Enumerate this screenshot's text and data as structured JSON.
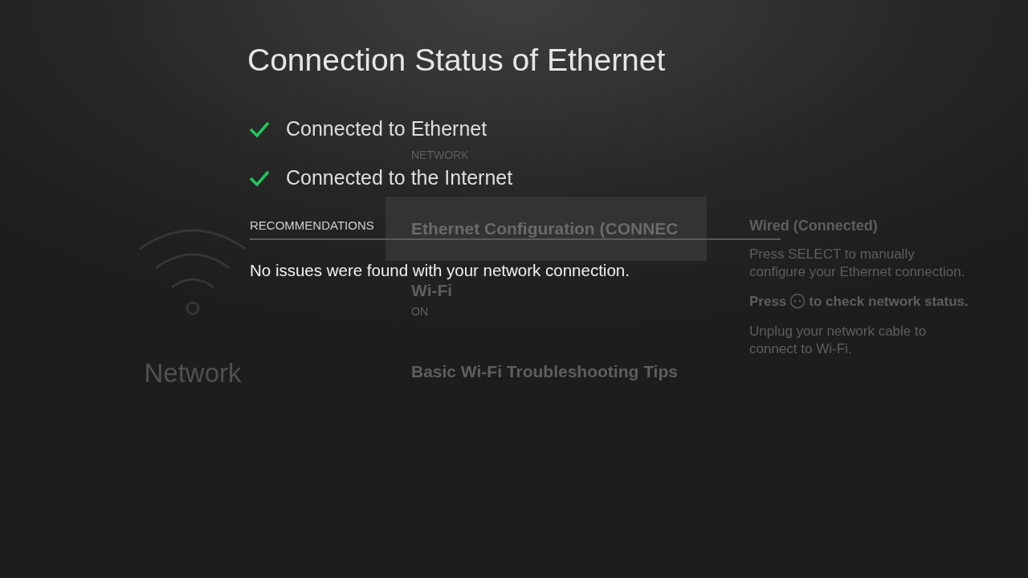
{
  "background": {
    "sidebar": {
      "title": "Network"
    },
    "menu": {
      "heading": "NETWORK",
      "items": [
        {
          "label": "Ethernet Configuration (CONNEC",
          "selected": true
        },
        {
          "label": "Wi-Fi",
          "subtitle": "ON",
          "selected": false
        },
        {
          "label": "Basic Wi-Fi Troubleshooting Tips",
          "selected": false
        }
      ]
    },
    "details": {
      "title": "Wired (Connected)",
      "paragraphs": [
        {
          "kind": "text",
          "text": "Press SELECT to manually configure your Ethernet connection."
        },
        {
          "kind": "button_hint",
          "before": "Press",
          "after": "to check network status."
        },
        {
          "kind": "text",
          "text": "Unplug your network cable to connect to Wi-Fi."
        }
      ]
    }
  },
  "dialog": {
    "title": "Connection Status of Ethernet",
    "checks": [
      {
        "label": "Connected to Ethernet",
        "ok": true
      },
      {
        "label": "Connected to the Internet",
        "ok": true
      }
    ],
    "section_heading": "RECOMMENDATIONS",
    "message": "No issues were found with your network connection."
  }
}
